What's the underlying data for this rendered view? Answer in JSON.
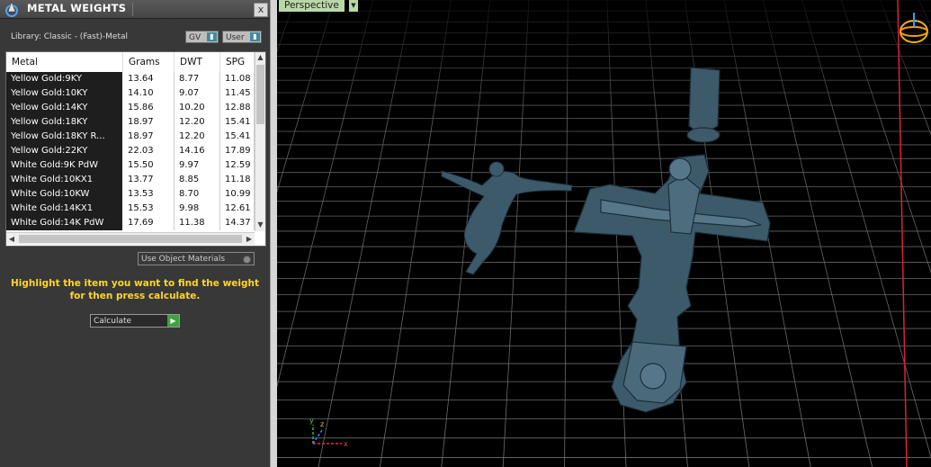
{
  "panel": {
    "title": "METAL WEIGHTS",
    "close_glyph": "x",
    "library_label": "Library: Classic - (Fast)-Metal",
    "gv_label": "GV",
    "user_label": "User",
    "columns": [
      "Metal",
      "Grams",
      "DWT",
      "SPG"
    ],
    "rows": [
      [
        "Yellow Gold:9KY",
        "13.64",
        "8.77",
        "11.08"
      ],
      [
        "Yellow Gold:10KY",
        "14.10",
        "9.07",
        "11.45"
      ],
      [
        "Yellow Gold:14KY",
        "15.86",
        "10.20",
        "12.88"
      ],
      [
        "Yellow Gold:18KY",
        "18.97",
        "12.20",
        "15.41"
      ],
      [
        "Yellow Gold:18KY R...",
        "18.97",
        "12.20",
        "15.41"
      ],
      [
        "Yellow Gold:22KY",
        "22.03",
        "14.16",
        "17.89"
      ],
      [
        "White Gold:9K PdW",
        "15.50",
        "9.97",
        "12.59"
      ],
      [
        "White Gold:10KX1",
        "13.77",
        "8.85",
        "11.18"
      ],
      [
        "White Gold:10KW",
        "13.53",
        "8.70",
        "10.99"
      ],
      [
        "White Gold:14KX1",
        "15.53",
        "9.98",
        "12.61"
      ],
      [
        "White Gold:14K PdW",
        "17.69",
        "11.38",
        "14.37"
      ]
    ],
    "use_object_materials": "Use Object Materials",
    "hint_line1": "Highlight the item you want to find the weight",
    "hint_line2": "for then press calculate.",
    "calculate_label": "Calculate"
  },
  "viewport": {
    "label": "Perspective",
    "menu_glyph": "▼",
    "axes": {
      "x": "x",
      "y": "y",
      "z": "z"
    }
  },
  "colors": {
    "accent_yellow": "#ffd52a",
    "viewport_label_bg": "#b9d8a7",
    "model_color": "#3d5a6b",
    "grid_color": "#6f6f6f",
    "calc_go": "#3da33a"
  },
  "icons": [
    "app-logo-icon",
    "close-icon",
    "dropdown-icon",
    "radio-icon",
    "go-arrow-icon",
    "axis-gizmo-icon",
    "orbit-gizmo-icon"
  ]
}
